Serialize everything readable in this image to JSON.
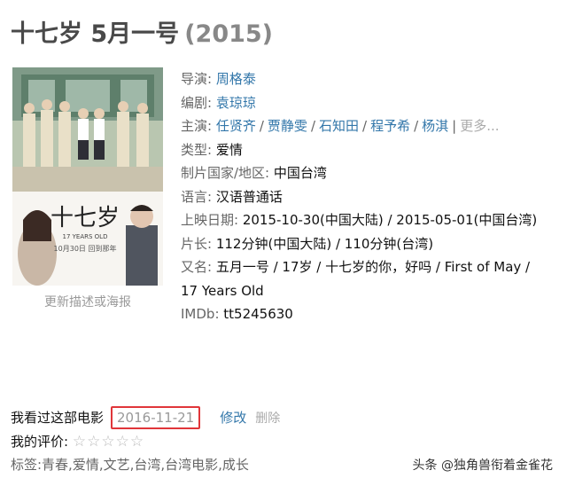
{
  "title": {
    "main": "十七岁 5月一号",
    "year": "(2015)"
  },
  "poster": {
    "alt": "poster",
    "big_title": "十七岁",
    "sub_title": "17 YEARS OLD",
    "date_text": "10月30日  回到那年"
  },
  "update_link": "更新描述或海报",
  "info": {
    "director_label": "导演:",
    "director": "周格泰",
    "writer_label": "编剧:",
    "writer": "袁琼琼",
    "cast_label": "主演:",
    "cast": [
      "任贤齐",
      "贾静雯",
      "石知田",
      "程予希",
      "杨淇"
    ],
    "cast_more": "更多...",
    "genre_label": "类型:",
    "genre": "爱情",
    "country_label": "制片国家/地区:",
    "country": "中国台湾",
    "language_label": "语言:",
    "language": "汉语普通话",
    "release_label": "上映日期:",
    "release": "2015-10-30(中国大陆) / 2015-05-01(中国台湾)",
    "runtime_label": "片长:",
    "runtime": "112分钟(中国大陆) / 110分钟(台湾)",
    "aka_label": "又名:",
    "aka": "五月一号 / 17岁 / 十七岁的你，好吗 / First of May /",
    "aka_cont": "17 Years Old",
    "imdb_label": "IMDb:",
    "imdb": "tt5245630"
  },
  "my": {
    "seen_label": "我看过这部电影",
    "seen_date": "2016-11-21",
    "edit": "修改",
    "delete": "删除",
    "rating_label": "我的评价:",
    "stars": [
      "☆",
      "☆",
      "☆",
      "☆",
      "☆"
    ],
    "tags": "标签:青春,爱情,文艺,台湾,台湾电影,成长"
  },
  "watermark": "头条 @独角兽衔着金雀花"
}
